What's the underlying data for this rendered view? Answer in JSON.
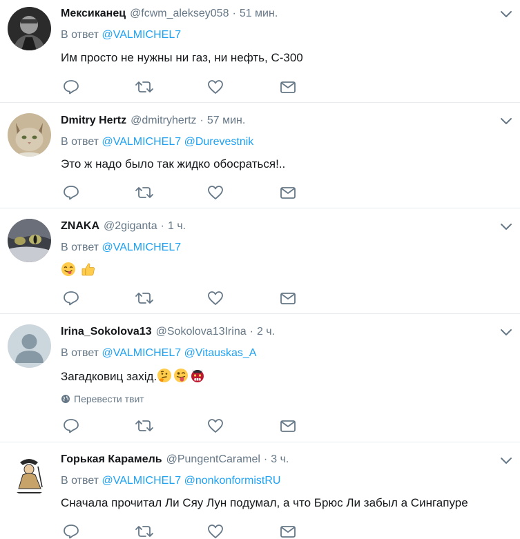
{
  "tweets": [
    {
      "name": "Мексиканец",
      "handle": "@fcwm_aleksey058",
      "dot": "·",
      "time": "51 мин.",
      "reply_prefix": "В ответ",
      "mentions": [
        "@VALMICHEL7"
      ],
      "text": "Им просто не нужны ни газ, ни нефть, С-300",
      "avatar_icon": "dark-portrait-avatar"
    },
    {
      "name": "Dmitry Hertz",
      "handle": "@dmitryhertz",
      "dot": "·",
      "time": "57 мин.",
      "reply_prefix": "В ответ",
      "mentions": [
        "@VALMICHEL7",
        "@Durevestnik"
      ],
      "text": "Это ж надо было так жидко обосраться!..",
      "avatar_icon": "cat-avatar"
    },
    {
      "name": "ZNAKA",
      "handle": "@2giganta",
      "dot": "·",
      "time": "1 ч.",
      "reply_prefix": "В ответ",
      "mentions": [
        "@VALMICHEL7"
      ],
      "text": "",
      "emojis": [
        "yum-face-emoji",
        "thumbs-up-emoji"
      ],
      "avatar_icon": "cat-eye-avatar"
    },
    {
      "name": "Irina_Sokolova13",
      "handle": "@Sokolova13Irina",
      "dot": "·",
      "time": "2 ч.",
      "reply_prefix": "В ответ",
      "mentions": [
        "@VALMICHEL7",
        "@Vitauskas_A"
      ],
      "text": "Загадковиц захід.",
      "emojis": [
        "thinking-face-emoji",
        "winking-tongue-emoji",
        "ogre-mask-emoji"
      ],
      "translate": "Перевести твит",
      "avatar_icon": "default-user-avatar"
    },
    {
      "name": "Горькая Карамель",
      "handle": "@PungentCaramel",
      "dot": "·",
      "time": "3 ч.",
      "reply_prefix": "В ответ",
      "mentions": [
        "@VALMICHEL7",
        "@nonkonformistRU"
      ],
      "text": "Сначала прочитал Ли Сяу Лун подумал, а что Брюс Ли забыл а Сингапуре",
      "avatar_icon": "samurai-drawing-avatar"
    }
  ],
  "colors": {
    "link": "#1da1f2",
    "secondary": "#657786",
    "divider": "#e6ecf0"
  }
}
